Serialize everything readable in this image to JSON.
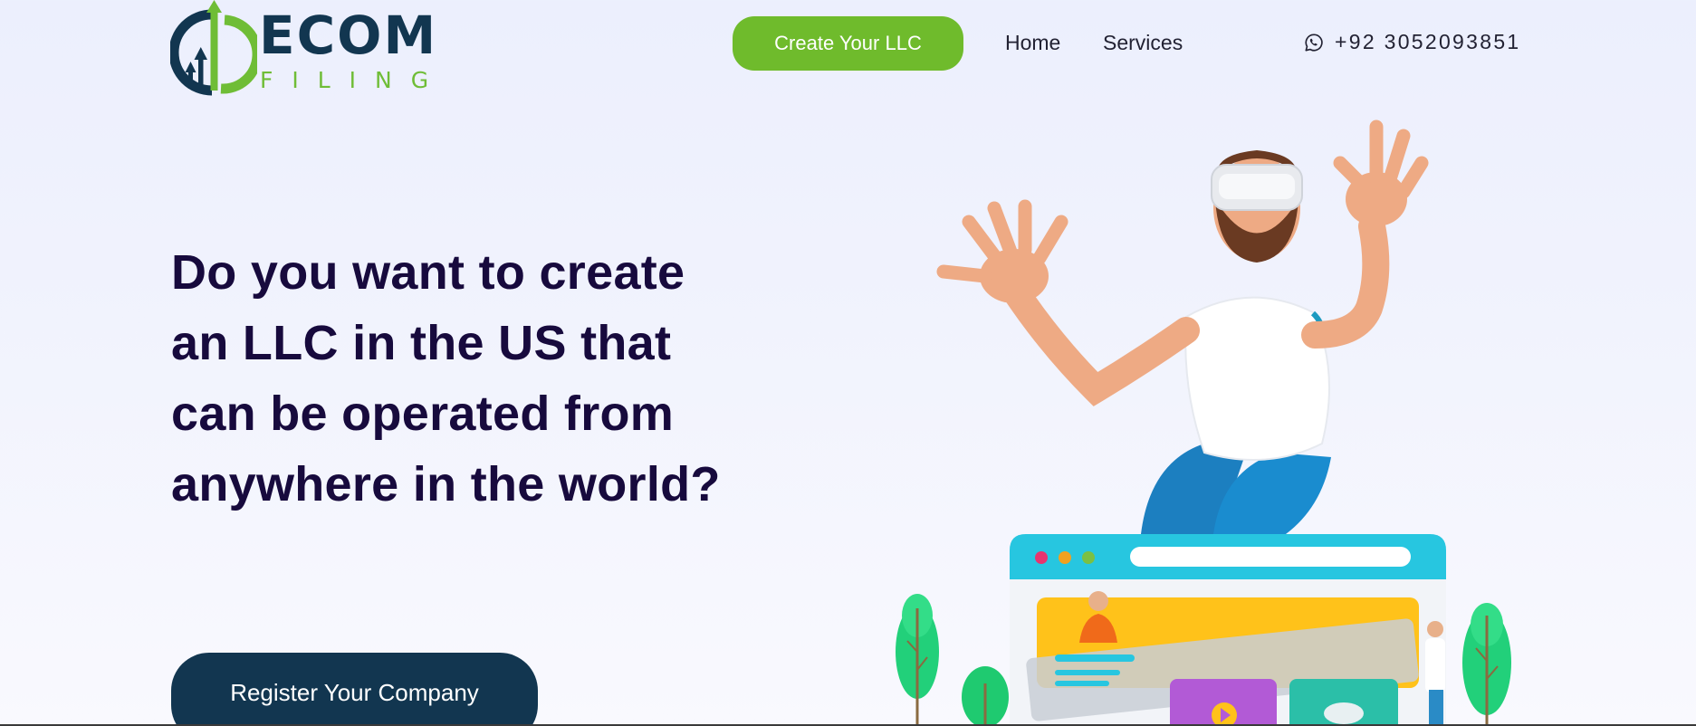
{
  "logo": {
    "word": "ECOM",
    "sub": "FILING"
  },
  "nav": {
    "cta_label": "Create Your LLC",
    "links": [
      "Home",
      "Services"
    ],
    "phone": "+92 3052093851"
  },
  "hero": {
    "headline": "Do you want to create an LLC in the US that can be operated from anywhere in the world?",
    "register_label": "Register Your Company"
  },
  "colors": {
    "brand_navy": "#123650",
    "brand_green": "#6fbb2c",
    "headline": "#170a3d"
  },
  "icons": {
    "phone": "whatsapp-icon",
    "logo_mark": "growth-arrow-icon"
  }
}
